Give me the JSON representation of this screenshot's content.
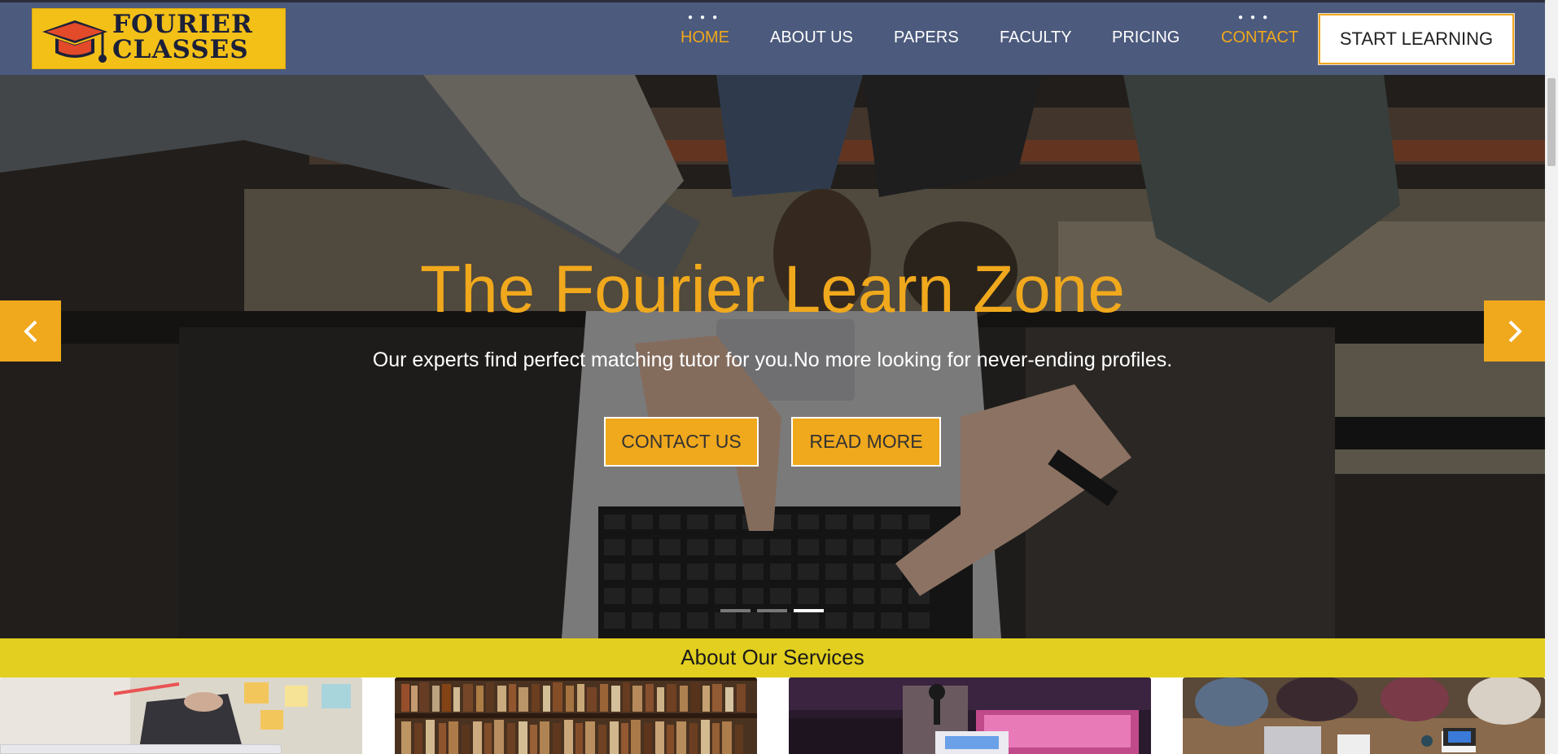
{
  "brand": {
    "line1": "FOURIER",
    "line2": "CLASSES"
  },
  "nav": {
    "items": [
      {
        "label": "HOME",
        "active": true
      },
      {
        "label": "ABOUT US",
        "active": false
      },
      {
        "label": "PAPERS",
        "active": false
      },
      {
        "label": "FACULTY",
        "active": false
      },
      {
        "label": "PRICING",
        "active": false
      },
      {
        "label": "CONTACT",
        "active": true
      }
    ],
    "cta": "START LEARNING"
  },
  "hero": {
    "title": "The Fourier Learn Zone",
    "subtitle": "Our experts find perfect matching tutor for you.No more looking for never-ending profiles.",
    "buttons": {
      "contact": "CONTACT US",
      "read_more": "READ MORE"
    },
    "slide_count": 3,
    "active_slide": 3
  },
  "services": {
    "title": "About Our Services"
  },
  "colors": {
    "navbar": "#4c5a7d",
    "accent": "#f0a81c",
    "logo_bg": "#f3c018",
    "band": "#e2cf1f"
  },
  "icons": {
    "prev": "chevron-left-icon",
    "next": "chevron-right-icon",
    "logo": "graduation-cap-icon"
  }
}
